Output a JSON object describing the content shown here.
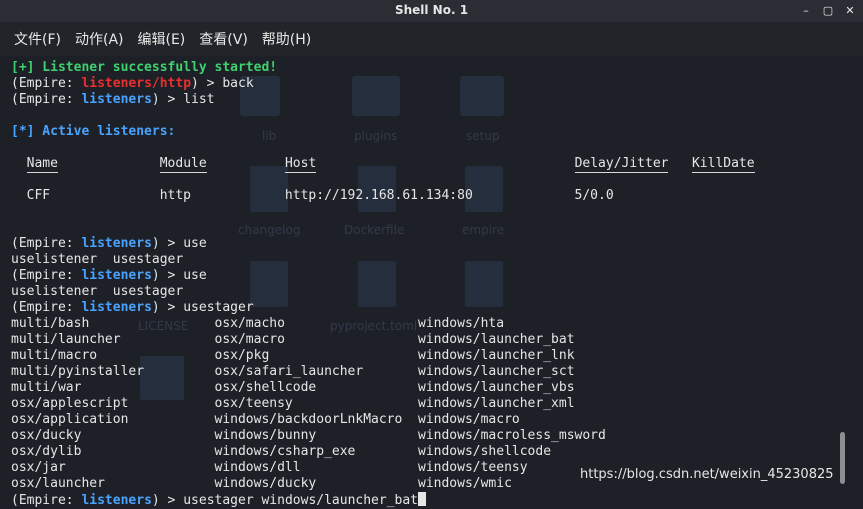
{
  "window": {
    "title": "Shell No. 1",
    "controls": [
      "–",
      "▢",
      "✕"
    ]
  },
  "menu": [
    "文件(F)",
    "动作(A)",
    "编辑(E)",
    "查看(V)",
    "帮助(H)"
  ],
  "terminal": {
    "lines": [
      {
        "segments": [
          {
            "t": "[+] Listener successfully started!",
            "c": "green"
          }
        ]
      },
      {
        "segments": [
          {
            "t": "(Empire: "
          },
          {
            "t": "listeners/http",
            "c": "red"
          },
          {
            "t": ") > back"
          }
        ]
      },
      {
        "segments": [
          {
            "t": "(Empire: "
          },
          {
            "t": "listeners",
            "c": "blue"
          },
          {
            "t": ") > list"
          }
        ]
      },
      {
        "segments": []
      },
      {
        "segments": [
          {
            "t": "[*] Active listeners:",
            "c": "blue"
          }
        ]
      },
      {
        "segments": []
      },
      {
        "segments": [
          {
            "t": "  "
          },
          {
            "t": "Name",
            "c": "hdr"
          },
          {
            "t": "             "
          },
          {
            "t": "Module",
            "c": "hdr"
          },
          {
            "t": "          "
          },
          {
            "t": "Host",
            "c": "hdr"
          },
          {
            "t": "                                 "
          },
          {
            "t": "Delay/Jitter",
            "c": "hdr"
          },
          {
            "t": "   "
          },
          {
            "t": "KillDate",
            "c": "hdr"
          }
        ]
      },
      {
        "segments": []
      },
      {
        "segments": [
          {
            "t": "  CFF              http            http://192.168.61.134:80             5/0.0"
          }
        ]
      },
      {
        "segments": []
      },
      {
        "segments": []
      },
      {
        "segments": [
          {
            "t": "(Empire: "
          },
          {
            "t": "listeners",
            "c": "blue"
          },
          {
            "t": ") > use"
          }
        ]
      },
      {
        "segments": [
          {
            "t": "uselistener  usestager"
          }
        ]
      },
      {
        "segments": [
          {
            "t": "(Empire: "
          },
          {
            "t": "listeners",
            "c": "blue"
          },
          {
            "t": ") > use"
          }
        ]
      },
      {
        "segments": [
          {
            "t": "uselistener  usestager"
          }
        ]
      },
      {
        "segments": [
          {
            "t": "(Empire: "
          },
          {
            "t": "listeners",
            "c": "blue"
          },
          {
            "t": ") > usestager"
          }
        ]
      },
      {
        "segments": [
          {
            "t": "multi/bash                osx/macho                 windows/hta"
          }
        ]
      },
      {
        "segments": [
          {
            "t": "multi/launcher            osx/macro                 windows/launcher_bat"
          }
        ]
      },
      {
        "segments": [
          {
            "t": "multi/macro               osx/pkg                   windows/launcher_lnk"
          }
        ]
      },
      {
        "segments": [
          {
            "t": "multi/pyinstaller         osx/safari_launcher       windows/launcher_sct"
          }
        ]
      },
      {
        "segments": [
          {
            "t": "multi/war                 osx/shellcode             windows/launcher_vbs"
          }
        ]
      },
      {
        "segments": [
          {
            "t": "osx/applescript           osx/teensy                windows/launcher_xml"
          }
        ]
      },
      {
        "segments": [
          {
            "t": "osx/application           windows/backdoorLnkMacro  windows/macro"
          }
        ]
      },
      {
        "segments": [
          {
            "t": "osx/ducky                 windows/bunny             windows/macroless_msword"
          }
        ]
      },
      {
        "segments": [
          {
            "t": "osx/dylib                 windows/csharp_exe        windows/shellcode"
          }
        ]
      },
      {
        "segments": [
          {
            "t": "osx/jar                   windows/dll               windows/teensy"
          }
        ]
      },
      {
        "segments": [
          {
            "t": "osx/launcher              windows/ducky             windows/wmic"
          }
        ]
      },
      {
        "segments": [
          {
            "t": "(Empire: "
          },
          {
            "t": "listeners",
            "c": "blue"
          },
          {
            "t": ") > usestager windows/launcher_bat"
          }
        ],
        "cursor": true
      }
    ]
  },
  "watermark": "https://blog.csdn.net/weixin_45230825",
  "background_labels": [
    "lib",
    "plugins",
    "setup",
    "changelog",
    "Dockerfile",
    "empire",
    "LICENSE",
    "pyproject.toml"
  ],
  "colors": {
    "green": "#3fd16f",
    "blue": "#4aa3ff",
    "red": "#e8302f",
    "background": "#1d2026"
  }
}
